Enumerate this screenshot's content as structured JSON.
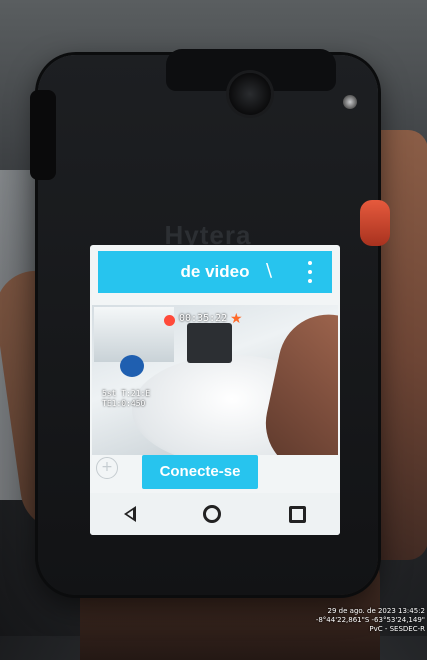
{
  "device": {
    "brand": "Hytera"
  },
  "app": {
    "title": "de video",
    "header_slash": "\\",
    "connect_label": "Conecte-se"
  },
  "video": {
    "rec_time": "00:35:22",
    "osd_lines": [
      "5st T:21:E",
      "TE1:0:450"
    ]
  },
  "overlay": {
    "line1": "29 de ago. de 2023 13:45:2",
    "line2": "-8°44'22,861\"S -63°53'24,149\"",
    "line3": "PvC - SESDEC-R"
  },
  "colors": {
    "accent": "#27c4ee",
    "rec": "#ff4a3a",
    "side_button": "#e65a3d"
  },
  "icons": [
    "menu-dots-icon",
    "circle-add-icon",
    "nav-back-icon",
    "nav-home-icon",
    "nav-recent-icon",
    "rec-dot-icon",
    "star-icon"
  ]
}
